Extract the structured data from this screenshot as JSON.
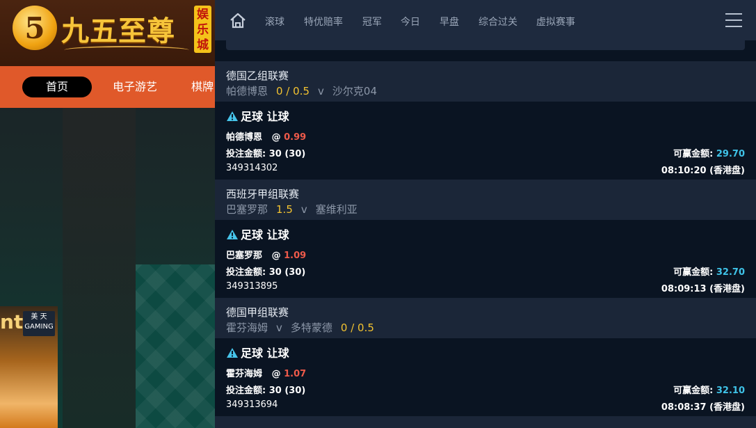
{
  "site": {
    "logo_mark": "5",
    "logo_text": "九五至尊",
    "logo_badge": "娱乐城",
    "nav": [
      "首页",
      "电子游艺",
      "棋牌"
    ],
    "promo_brand": "nt",
    "promo_badge_top": "美 天",
    "promo_badge_bottom": "GAMING"
  },
  "topbar": {
    "home_icon": "home-icon",
    "tabs": [
      "滚球",
      "特优赔率",
      "冠军",
      "今日",
      "早盘",
      "综合过关",
      "虚拟赛事"
    ],
    "menu_icon": "hamburger-icon"
  },
  "colors": {
    "accent_cyan": "#3fc3e8",
    "odds_red": "#ee5a4a",
    "handicap_yellow": "#f2c230",
    "panel_bg": "#0a1422",
    "league_bg": "#1b2638"
  },
  "bets": [
    {
      "league": "德国乙组联赛",
      "home": "帕德博恩",
      "handicap": "0 / 0.5",
      "vs": "v",
      "away": "沙尔克04",
      "title": "足球 让球",
      "selection": "帕德博恩",
      "at": "@",
      "odds": "0.99",
      "stake_label": "投注金额:",
      "stake": "30 (30)",
      "win_label": "可赢金额:",
      "win": "29.70",
      "bet_id": "349314302",
      "time": "08:10:20 (香港盘)"
    },
    {
      "league": "西班牙甲组联赛",
      "home": "巴塞罗那",
      "handicap": "1.5",
      "vs": "v",
      "away": "塞维利亚",
      "title": "足球 让球",
      "selection": "巴塞罗那",
      "at": "@",
      "odds": "1.09",
      "stake_label": "投注金额:",
      "stake": "30 (30)",
      "win_label": "可赢金额:",
      "win": "32.70",
      "bet_id": "349313895",
      "time": "08:09:13 (香港盘)"
    },
    {
      "league": "德国甲组联赛",
      "home": "霍芬海姆",
      "vs": "v",
      "away": "多特蒙德",
      "handicap": "0 / 0.5",
      "title": "足球 让球",
      "selection": "霍芬海姆",
      "at": "@",
      "odds": "1.07",
      "stake_label": "投注金额:",
      "stake": "30 (30)",
      "win_label": "可赢金额:",
      "win": "32.10",
      "bet_id": "349313694",
      "time": "08:08:37 (香港盘)"
    }
  ]
}
